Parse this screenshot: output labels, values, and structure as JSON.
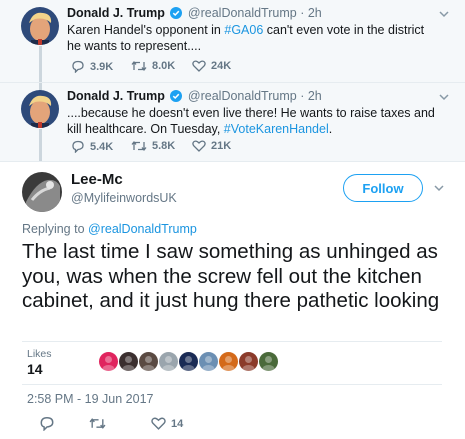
{
  "tweet1": {
    "name": "Donald J. Trump",
    "handle": "@realDonaldTrump",
    "time": "2h",
    "text_a": "Karen Handel's opponent in ",
    "hashtag": "#GA06",
    "text_b": " can't even vote in the district he wants to represent....",
    "replies": "3.9K",
    "retweets": "8.0K",
    "likes": "24K"
  },
  "tweet2": {
    "name": "Donald J. Trump",
    "handle": "@realDonaldTrump",
    "time": "2h",
    "text_a": "....because he doesn't even live there! He wants to raise taxes and kill healthcare. On Tuesday, ",
    "hashtag": "#VoteKarenHandel",
    "text_b": ".",
    "replies": "5.4K",
    "retweets": "5.8K",
    "likes": "21K"
  },
  "main": {
    "name": "Lee-Mc",
    "handle": "@MylifeinwordsUK",
    "follow_label": "Follow",
    "replying_prefix": "Replying to ",
    "replying_to": "@realDonaldTrump",
    "body": "The last time I saw something as unhinged as you, was when the screw fell out the kitchen cabinet, and it just hung there pathetic looking",
    "likes_label": "Likes",
    "likes_count": "14",
    "timestamp": "2:58 PM - 19 Jun 2017",
    "like_action_count": "14"
  },
  "icons": {
    "verified": "verified-badge-icon",
    "reply": "reply-icon",
    "retweet": "retweet-icon",
    "like": "heart-icon",
    "caret": "chevron-down-icon"
  },
  "colors": {
    "accent": "#1da1f2",
    "link": "#1b95e0",
    "muted": "#657786",
    "thread_bg": "#f5f8fa"
  },
  "likers": [
    "#e0245e",
    "#3b2f2f",
    "#5a4a42",
    "#9aa5ad",
    "#1a2b55",
    "#6b8fb3",
    "#d46a1a",
    "#8b3a2a",
    "#4a6a3a"
  ]
}
